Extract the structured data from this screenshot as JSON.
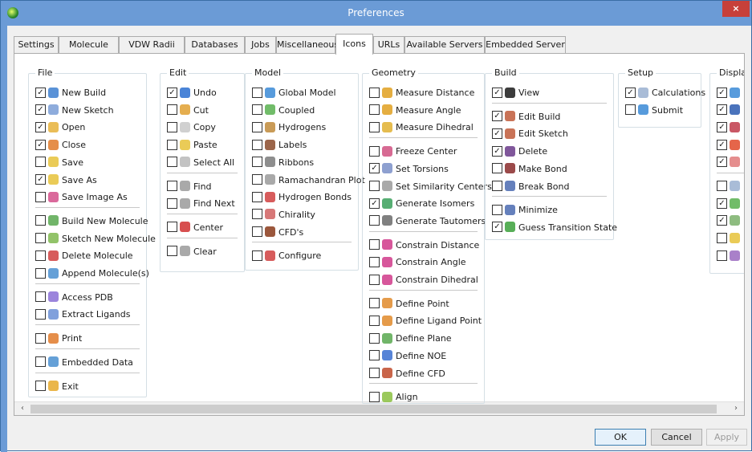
{
  "window": {
    "title": "Preferences",
    "close_glyph": "×"
  },
  "tabs": [
    "Settings",
    "Molecule",
    "VDW Radii",
    "Databases",
    "Jobs",
    "Miscellaneous",
    "Icons",
    "URLs",
    "Available Servers",
    "Embedded Server"
  ],
  "active_tab": "Icons",
  "groups": [
    {
      "title": "File",
      "items": [
        {
          "label": "New Build",
          "checked": true,
          "icon": "new-build-icon",
          "color": "#3d7fd0"
        },
        {
          "label": "New Sketch",
          "checked": true,
          "icon": "new-sketch-icon",
          "color": "#7a9ed6"
        },
        {
          "label": "Open",
          "checked": true,
          "icon": "open-icon",
          "color": "#e6b13a"
        },
        {
          "label": "Close",
          "checked": true,
          "icon": "close-icon",
          "color": "#e07a2a"
        },
        {
          "label": "Save",
          "checked": false,
          "icon": "save-icon",
          "color": "#e6c23a"
        },
        {
          "label": "Save As",
          "checked": true,
          "icon": "save-as-icon",
          "color": "#e6c23a"
        },
        {
          "label": "Save Image As",
          "checked": false,
          "icon": "save-image-icon",
          "color": "#d44f8a"
        },
        {
          "sep": true
        },
        {
          "label": "Build New Molecule",
          "checked": false,
          "icon": "build-molecule-icon",
          "color": "#58a84f"
        },
        {
          "label": "Sketch New Molecule",
          "checked": false,
          "icon": "sketch-molecule-icon",
          "color": "#7fb84f"
        },
        {
          "label": "Delete Molecule",
          "checked": false,
          "icon": "delete-molecule-icon",
          "color": "#d04040"
        },
        {
          "label": "Append Molecule(s)",
          "checked": false,
          "icon": "append-molecule-icon",
          "color": "#4a8fd0"
        },
        {
          "sep": true
        },
        {
          "label": "Access PDB",
          "checked": false,
          "icon": "pdb-icon",
          "color": "#8a6fd6"
        },
        {
          "label": "Extract Ligands",
          "checked": false,
          "icon": "extract-ligands-icon",
          "color": "#6a8fd6"
        },
        {
          "sep": true
        },
        {
          "label": "Print",
          "checked": false,
          "icon": "print-icon",
          "color": "#e07a2a"
        },
        {
          "sep": true
        },
        {
          "label": "Embedded Data",
          "checked": false,
          "icon": "embedded-data-icon",
          "color": "#4a8fd0"
        },
        {
          "sep": true
        },
        {
          "label": "Exit",
          "checked": false,
          "icon": "exit-icon",
          "color": "#e6a92a"
        }
      ]
    },
    {
      "title": "Edit",
      "items": [
        {
          "label": "Undo",
          "checked": true,
          "icon": "undo-icon",
          "color": "#2a6fd0"
        },
        {
          "label": "Cut",
          "checked": false,
          "icon": "cut-icon",
          "color": "#e0a030"
        },
        {
          "label": "Copy",
          "checked": false,
          "icon": "copy-icon",
          "color": "#c8c8c8"
        },
        {
          "label": "Paste",
          "checked": false,
          "icon": "paste-icon",
          "color": "#e6c23a"
        },
        {
          "label": "Select All",
          "checked": false,
          "icon": "select-all-icon",
          "color": "#b8b8b8"
        },
        {
          "sep": true
        },
        {
          "label": "Find",
          "checked": false,
          "icon": "find-icon",
          "color": "#9a9a9a"
        },
        {
          "label": "Find Next",
          "checked": false,
          "icon": "find-next-icon",
          "color": "#9a9a9a"
        },
        {
          "sep": true
        },
        {
          "label": "Center",
          "checked": false,
          "icon": "center-icon",
          "color": "#d03030"
        },
        {
          "sep": true
        },
        {
          "label": "Clear",
          "checked": false,
          "icon": "clear-icon",
          "color": "#9a9a9a"
        }
      ]
    },
    {
      "title": "Model",
      "items": [
        {
          "label": "Global Model",
          "checked": false,
          "icon": "global-model-icon",
          "color": "#3a8ad6"
        },
        {
          "label": "Coupled",
          "checked": false,
          "icon": "coupled-icon",
          "color": "#58b04f"
        },
        {
          "label": "Hydrogens",
          "checked": false,
          "icon": "hydrogens-icon",
          "color": "#c08a3a"
        },
        {
          "label": "Labels",
          "checked": false,
          "icon": "labels-icon",
          "color": "#8a4a2a"
        },
        {
          "label": "Ribbons",
          "checked": false,
          "icon": "ribbons-icon",
          "color": "#7a7a7a"
        },
        {
          "label": "Ramachandran Plot",
          "checked": false,
          "icon": "ramachandran-icon",
          "color": "#9a9a9a"
        },
        {
          "label": "Hydrogen Bonds",
          "checked": false,
          "icon": "hydrogen-bonds-icon",
          "color": "#d04040"
        },
        {
          "label": "Chirality",
          "checked": false,
          "icon": "chirality-icon",
          "color": "#d06060"
        },
        {
          "label": "CFD's",
          "checked": false,
          "icon": "cfd-icon",
          "color": "#8a3a1a"
        },
        {
          "sep": true
        },
        {
          "label": "Configure",
          "checked": false,
          "icon": "configure-icon",
          "color": "#d04040"
        }
      ]
    },
    {
      "title": "Geometry",
      "items": [
        {
          "label": "Measure Distance",
          "checked": false,
          "icon": "measure-distance-icon",
          "color": "#e0a020"
        },
        {
          "label": "Measure Angle",
          "checked": false,
          "icon": "measure-angle-icon",
          "color": "#e0a020"
        },
        {
          "label": "Measure Dihedral",
          "checked": false,
          "icon": "measure-dihedral-icon",
          "color": "#e0b030"
        },
        {
          "sep": true
        },
        {
          "label": "Freeze Center",
          "checked": false,
          "icon": "freeze-center-icon",
          "color": "#d05080"
        },
        {
          "label": "Set Torsions",
          "checked": true,
          "icon": "set-torsions-icon",
          "color": "#7a8fc8"
        },
        {
          "label": "Set Similarity Centers",
          "checked": false,
          "icon": "similarity-centers-icon",
          "color": "#9a9a9a"
        },
        {
          "label": "Generate Isomers",
          "checked": true,
          "icon": "generate-isomers-icon",
          "color": "#3aa05a"
        },
        {
          "label": "Generate Tautomers",
          "checked": false,
          "icon": "generate-tautomers-icon",
          "color": "#6a6a6a"
        },
        {
          "sep": true
        },
        {
          "label": "Constrain Distance",
          "checked": false,
          "icon": "constrain-distance-icon",
          "color": "#d03a8a"
        },
        {
          "label": "Constrain Angle",
          "checked": false,
          "icon": "constrain-angle-icon",
          "color": "#d03a8a"
        },
        {
          "label": "Constrain Dihedral",
          "checked": false,
          "icon": "constrain-dihedral-icon",
          "color": "#d03a8a"
        },
        {
          "sep": true
        },
        {
          "label": "Define Point",
          "checked": false,
          "icon": "define-point-icon",
          "color": "#e08a2a"
        },
        {
          "label": "Define Ligand Point",
          "checked": false,
          "icon": "define-ligand-point-icon",
          "color": "#e08a2a"
        },
        {
          "label": "Define Plane",
          "checked": false,
          "icon": "define-plane-icon",
          "color": "#58a84f"
        },
        {
          "label": "Define NOE",
          "checked": false,
          "icon": "define-noe-icon",
          "color": "#3a6fd0"
        },
        {
          "label": "Define CFD",
          "checked": false,
          "icon": "define-cfd-icon",
          "color": "#c04a2a"
        },
        {
          "sep": true
        },
        {
          "label": "Align",
          "checked": false,
          "icon": "align-icon",
          "color": "#8ac040"
        }
      ]
    },
    {
      "title": "Build",
      "items": [
        {
          "label": "View",
          "checked": true,
          "icon": "view-glasses-icon",
          "color": "#1a1a1a"
        },
        {
          "sep": true
        },
        {
          "label": "Edit Build",
          "checked": true,
          "icon": "edit-build-icon",
          "color": "#c05a3a"
        },
        {
          "label": "Edit Sketch",
          "checked": true,
          "icon": "edit-sketch-icon",
          "color": "#c05a3a"
        },
        {
          "label": "Delete",
          "checked": true,
          "icon": "delete-icon",
          "color": "#6a3a8a"
        },
        {
          "label": "Make Bond",
          "checked": false,
          "icon": "make-bond-icon",
          "color": "#8a2a2a"
        },
        {
          "label": "Break Bond",
          "checked": false,
          "icon": "break-bond-icon",
          "color": "#4a6ab0"
        },
        {
          "sep": true
        },
        {
          "label": "Minimize",
          "checked": false,
          "icon": "minimize-icon",
          "color": "#4a6ab0"
        },
        {
          "label": "Guess Transition State",
          "checked": true,
          "icon": "transition-state-icon",
          "color": "#3aa03a"
        }
      ]
    },
    {
      "title": "Setup",
      "items": [
        {
          "label": "Calculations",
          "checked": true,
          "icon": "calculations-icon",
          "color": "#9ab0d0"
        },
        {
          "label": "Submit",
          "checked": false,
          "icon": "submit-icon",
          "color": "#3a8ad6"
        }
      ]
    },
    {
      "title": "Displa",
      "items": [
        {
          "label": "",
          "checked": true,
          "icon": "display-1-icon",
          "color": "#3a8ad6"
        },
        {
          "label": "",
          "checked": true,
          "icon": "display-2-icon",
          "color": "#2a5ab0"
        },
        {
          "label": "",
          "checked": true,
          "icon": "display-3-icon",
          "color": "#c03a4a"
        },
        {
          "label": "",
          "checked": true,
          "icon": "display-4-icon",
          "color": "#e04a2a"
        },
        {
          "label": "",
          "checked": true,
          "icon": "display-5-icon",
          "color": "#e07a7a"
        },
        {
          "sep": true
        },
        {
          "label": "",
          "checked": false,
          "icon": "display-6-icon",
          "color": "#9ab0d0"
        },
        {
          "label": "",
          "checked": true,
          "icon": "display-7-icon",
          "color": "#58b04f"
        },
        {
          "label": "",
          "checked": true,
          "icon": "display-8-icon",
          "color": "#7ab06a"
        },
        {
          "label": "",
          "checked": false,
          "icon": "display-9-icon",
          "color": "#e6c23a"
        },
        {
          "label": "",
          "checked": false,
          "icon": "display-10-icon",
          "color": "#9a6ac0"
        }
      ]
    }
  ],
  "buttons": {
    "ok": "OK",
    "cancel": "Cancel",
    "apply": "Apply"
  },
  "scroll": {
    "left_arrow": "‹",
    "right_arrow": "›"
  }
}
